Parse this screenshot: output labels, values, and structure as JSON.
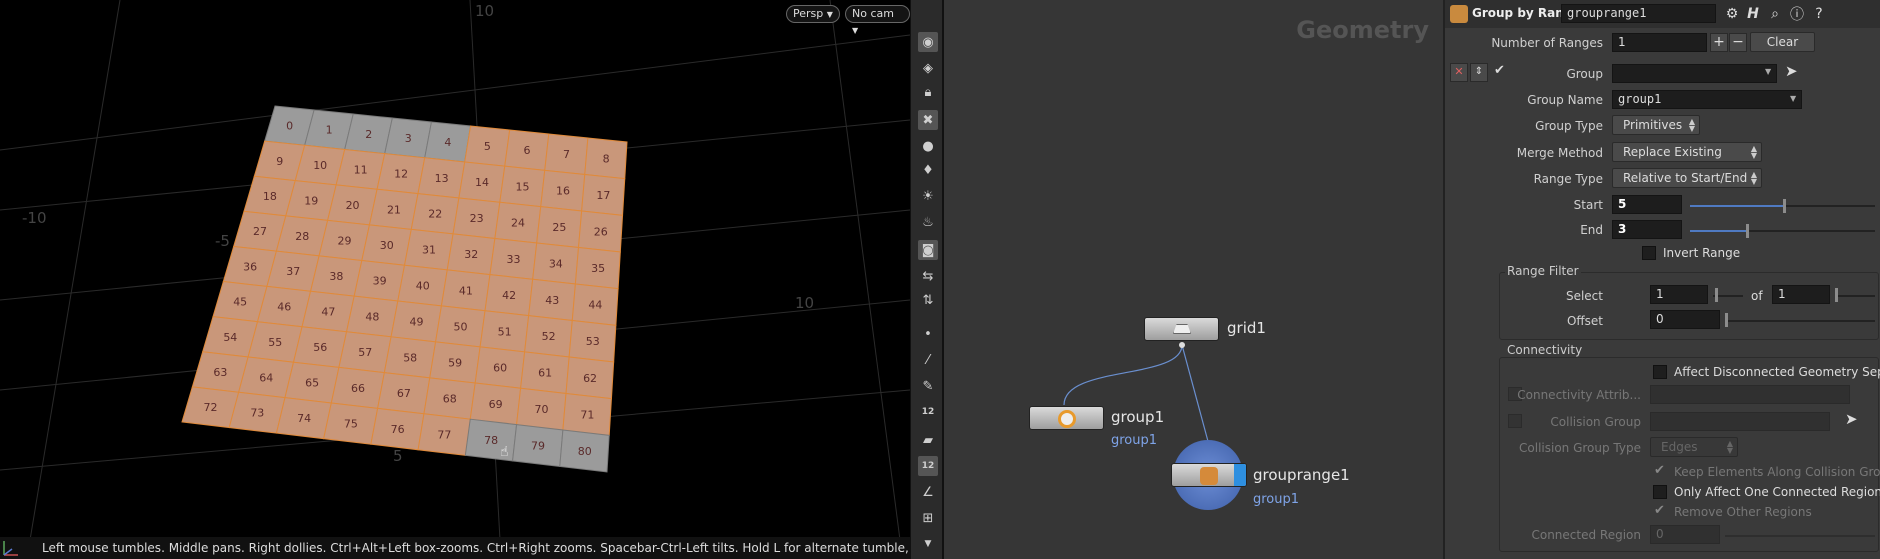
{
  "viewport": {
    "persp_label": "Persp",
    "cam_label": "No cam",
    "axis_labels": [
      "10",
      "-10",
      "-5",
      "10",
      "5"
    ],
    "status_text": "Left mouse tumbles. Middle pans. Right dollies. Ctrl+Alt+Left box-zooms. Ctrl+Right zooms. Spacebar-Ctrl-Left tilts. Hold L for alternate tumble, dolly, and zoom.",
    "grid": {
      "rows": 9,
      "cols": 9,
      "highlight_color": "#c9977a",
      "unselected_color": "#9b9b9b",
      "unselected_primitives": [
        0,
        1,
        2,
        3,
        4,
        78,
        79,
        80
      ]
    }
  },
  "toolbar": {
    "icons": [
      "eye-icon",
      "eye-plus-icon",
      "lock-icon",
      "close-box-icon",
      "sphere-icon",
      "light-icon",
      "light-bulb-icon",
      "camera-light-icon",
      "camera-icon",
      "camera-pan-icon",
      "camera-dolly-icon",
      "dot-icon",
      "brush-icon",
      "pen-icon",
      "number-12-icon",
      "layer-icon",
      "number-12-box-icon",
      "angle-icon",
      "snap-icon",
      "scroll-down-icon"
    ],
    "badge_number": "12"
  },
  "network": {
    "context_title": "Geometry",
    "nodes": {
      "grid": {
        "name": "grid1"
      },
      "group": {
        "name": "group1",
        "group_label": "group1"
      },
      "grouprange": {
        "name": "grouprange1",
        "group_label": "group1"
      }
    }
  },
  "params": {
    "node_type": "Group by Range",
    "node_name": "grouprange1",
    "number_of_ranges": {
      "label": "Number of Ranges",
      "value": "1",
      "clear_label": "Clear"
    },
    "group": {
      "label": "Group",
      "value": ""
    },
    "group_name": {
      "label": "Group Name",
      "value": "group1"
    },
    "group_type": {
      "label": "Group Type",
      "value": "Primitives"
    },
    "merge_method": {
      "label": "Merge Method",
      "value": "Replace Existing"
    },
    "range_type": {
      "label": "Range Type",
      "value": "Relative to Start/End"
    },
    "start": {
      "label": "Start",
      "value": "5",
      "slider": 0.5
    },
    "end": {
      "label": "End",
      "value": "3",
      "slider": 0.3
    },
    "invert_range": {
      "label": "Invert Range",
      "checked": false
    },
    "range_filter": {
      "title": "Range Filter",
      "select_label": "Select",
      "select_a": "1",
      "of_label": "of",
      "select_b": "1",
      "offset_label": "Offset",
      "offset_value": "0"
    },
    "connectivity": {
      "title": "Connectivity",
      "affect_disconnected": "Affect Disconnected Geometry Sep...",
      "connectivity_attrib": "Connectivity Attrib...",
      "collision_group": "Collision Group",
      "collision_group_type_label": "Collision Group Type",
      "collision_group_type_value": "Edges",
      "keep_elements": "Keep Elements Along Collision Gro...",
      "only_affect_one": "Only Affect One Connected Region",
      "remove_other": "Remove Other Regions",
      "connected_region_label": "Connected Region",
      "connected_region_value": "0"
    }
  }
}
